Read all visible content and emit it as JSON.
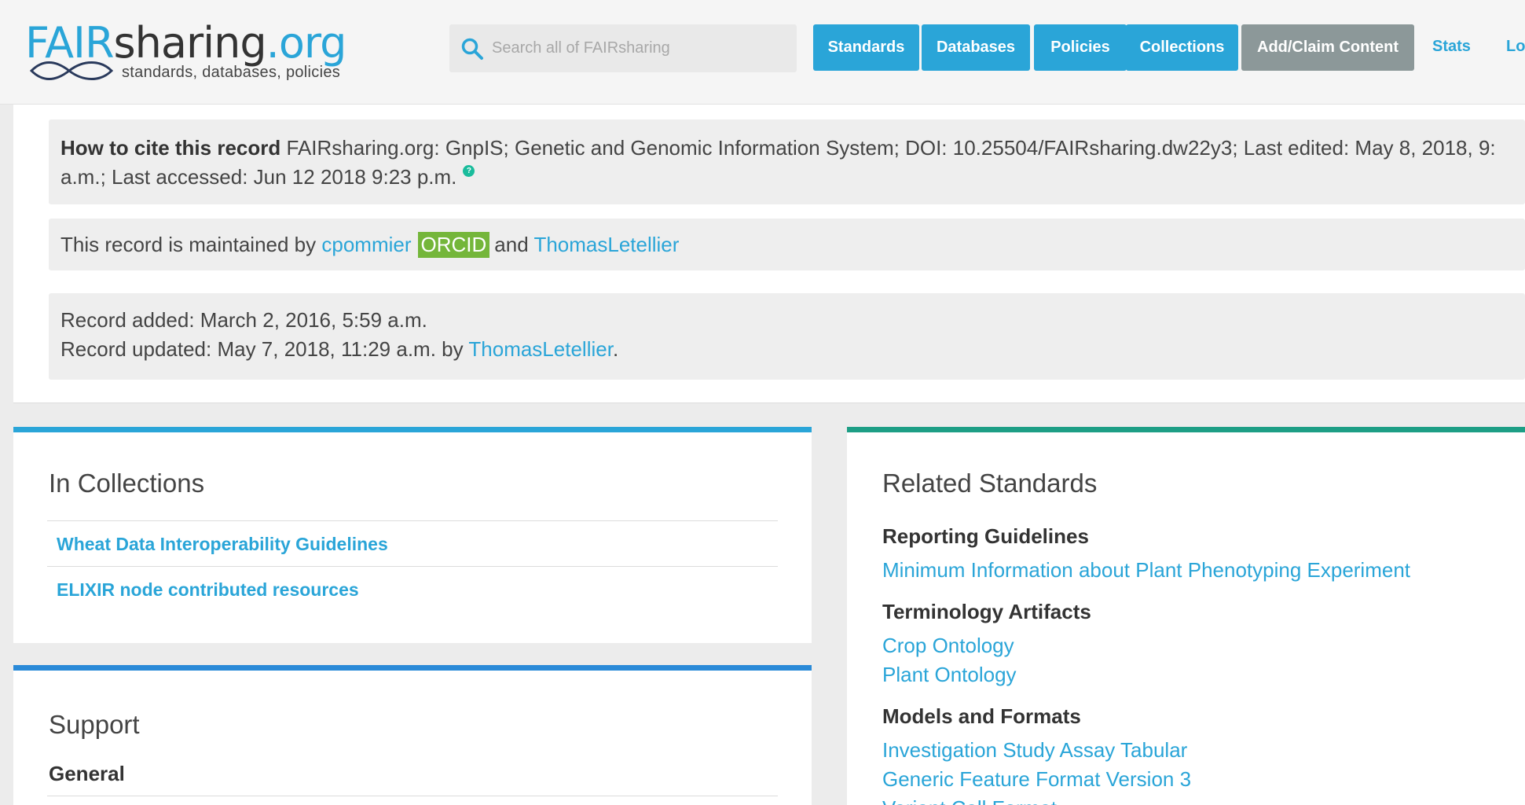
{
  "header": {
    "logo": {
      "fair": "FAIR",
      "sharing": "sharing",
      "org": ".org",
      "tagline": "standards, databases, policies"
    },
    "search": {
      "placeholder": "Search all of FAIRsharing"
    },
    "nav": [
      "Standards",
      "Databases",
      "Policies",
      "Collections",
      "Add/Claim Content"
    ],
    "links": {
      "stats": "Stats",
      "login": "Log"
    }
  },
  "record": {
    "cite_label": "How to cite this record",
    "cite_line1": "FAIRsharing.org: GnpIS; Genetic and Genomic Information System; DOI: 10.25504/FAIRsharing.dw22y3; Last edited: May 8, 2018, 9:",
    "cite_line2": "a.m.; Last accessed: Jun 12 2018 9:23 p.m.",
    "help_glyph": "?",
    "maintained_prefix": "This record is maintained by",
    "maintainer1": "cpommier",
    "orcid": "ORCID",
    "and_text": "and",
    "maintainer2": "ThomasLetellier",
    "added": "Record added: March 2, 2016, 5:59 a.m.",
    "updated_prefix": "Record updated: May 7, 2018, 11:29 a.m. by",
    "updated_by": "ThomasLetellier",
    "updated_suffix": "."
  },
  "collections": {
    "title": "In Collections",
    "items": [
      "Wheat Data Interoperability Guidelines",
      "ELIXIR node contributed resources"
    ]
  },
  "support": {
    "title": "Support",
    "general": "General"
  },
  "related": {
    "title": "Related Standards",
    "groups": [
      {
        "heading": "Reporting Guidelines",
        "items": [
          "Minimum Information about Plant Phenotyping Experiment"
        ]
      },
      {
        "heading": "Terminology Artifacts",
        "items": [
          "Crop Ontology",
          "Plant Ontology"
        ]
      },
      {
        "heading": "Models and Formats",
        "items": [
          "Investigation Study Assay Tabular",
          "Generic Feature Format Version 3",
          "Variant Call Format"
        ]
      }
    ]
  },
  "colors": {
    "accent": "#2aa5d8",
    "orcid": "#74b63a",
    "green_rule": "#1d9e85",
    "gray_button": "#8c9899"
  }
}
